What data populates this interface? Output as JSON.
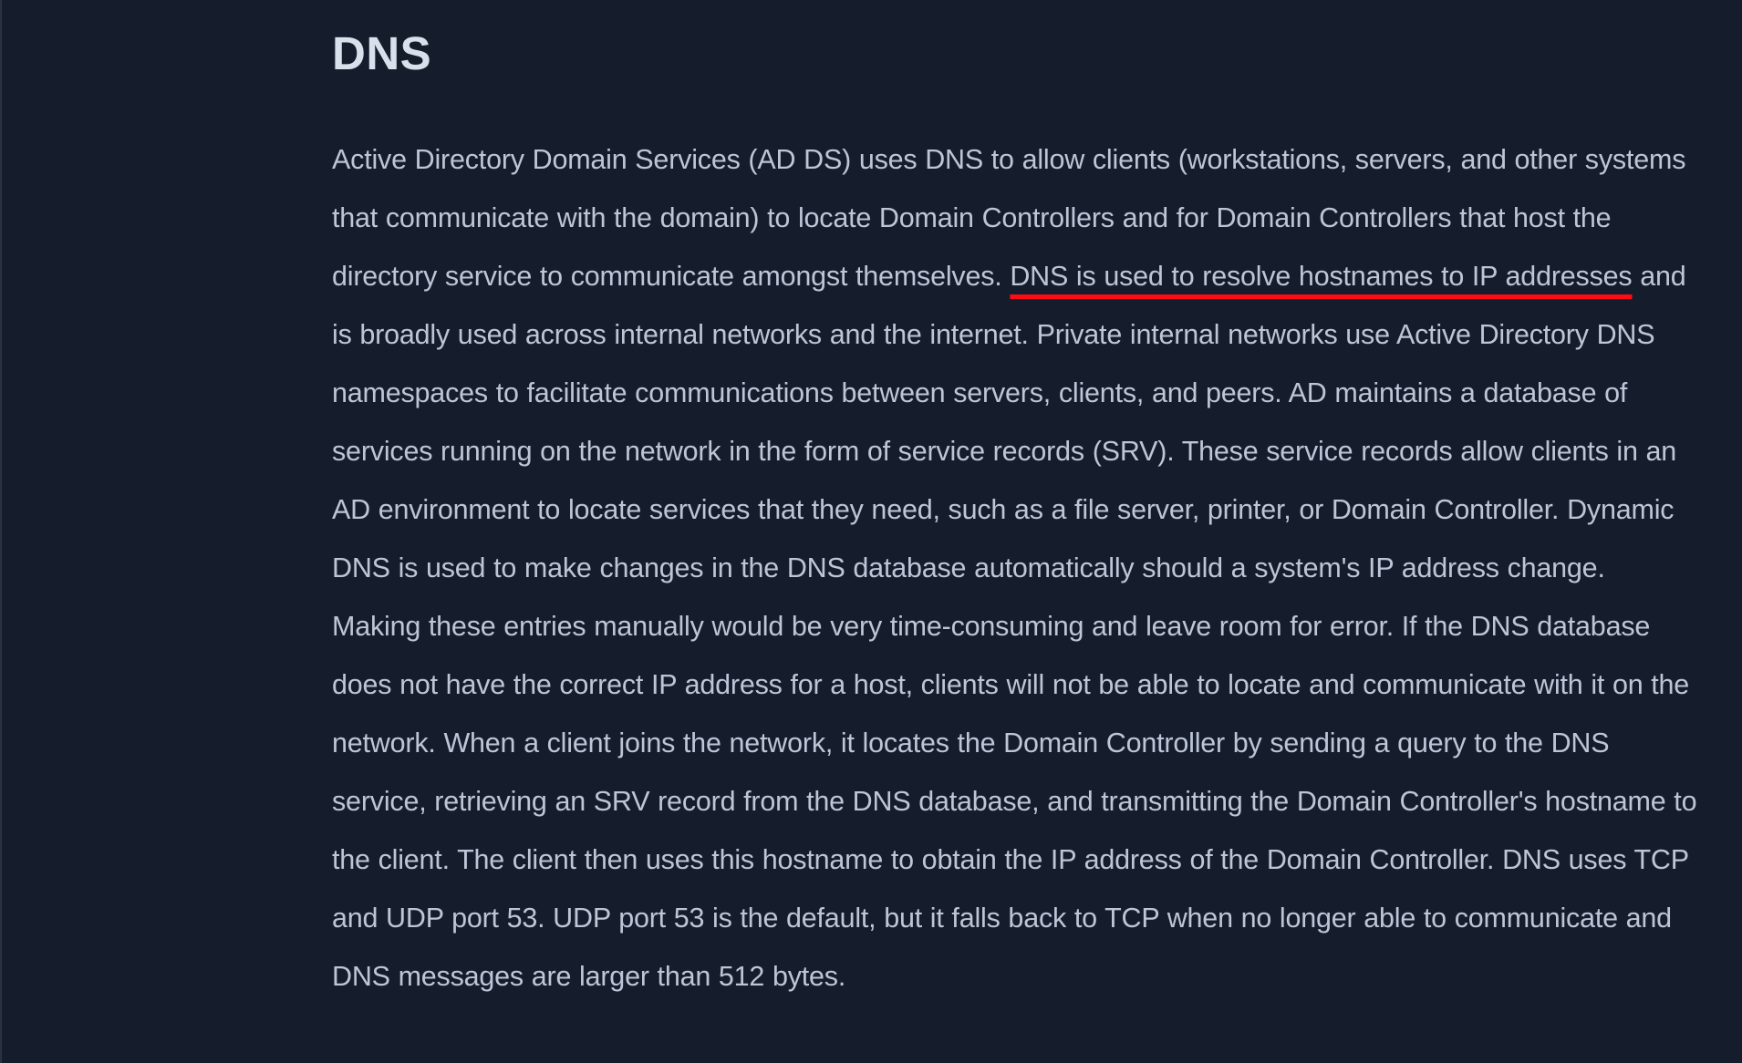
{
  "article": {
    "title": "DNS",
    "paragraph": {
      "before_highlight": "Active Directory Domain Services (AD DS) uses DNS to allow clients (workstations, servers, and other systems that communicate with the domain) to locate Domain Controllers and for Domain Controllers that host the directory service to communicate amongst themselves. ",
      "highlight": "DNS is used to resolve hostnames to IP addresses",
      "after_highlight": " and is broadly used across internal networks and the internet. Private internal networks use Active Directory DNS namespaces to facilitate communications between servers, clients, and peers. AD maintains a database of services running on the network in the form of service records (SRV). These service records allow clients in an AD environment to locate services that they need, such as a file server, printer, or Domain Controller. Dynamic DNS is used to make changes in the DNS database automatically should a system's IP address change. Making these entries manually would be very time-consuming and leave room for error. If the DNS database does not have the correct IP address for a host, clients will not be able to locate and communicate with it on the network. When a client joins the network, it locates the Domain Controller by sending a query to the DNS service, retrieving an SRV record from the DNS database, and transmitting the Domain Controller's hostname to the client. The client then uses this hostname to obtain the IP address of the Domain Controller. DNS uses TCP and UDP port 53. UDP port 53 is the default, but it falls back to TCP when no longer able to communicate and DNS messages are larger than 512 bytes."
    }
  },
  "colors": {
    "background": "#151d2c",
    "title_text": "#d8e0ec",
    "body_text": "#bcc6d6",
    "annotation_underline": "#ff0a16"
  }
}
